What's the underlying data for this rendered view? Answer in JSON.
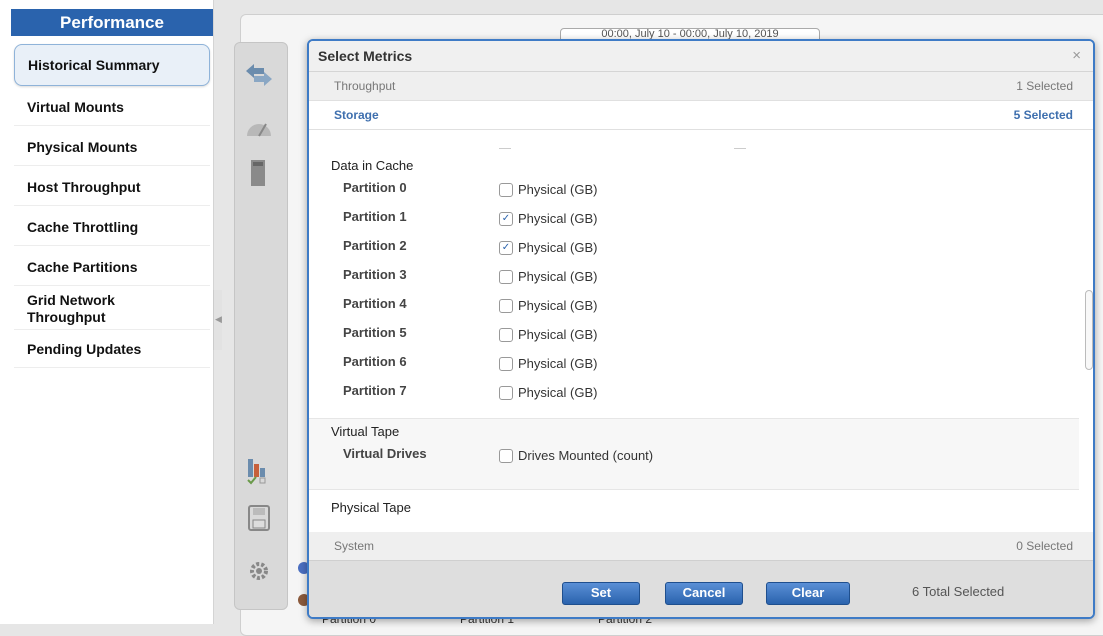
{
  "sidebar": {
    "title": "Performance",
    "items": [
      {
        "label": "Historical Summary"
      },
      {
        "label": "Virtual Mounts"
      },
      {
        "label": "Physical Mounts"
      },
      {
        "label": "Host Throughput"
      },
      {
        "label": "Cache Throttling"
      },
      {
        "label": "Cache Partitions"
      },
      {
        "label": "Grid Network Throughput"
      },
      {
        "label": "Pending Updates"
      }
    ]
  },
  "background": {
    "date_range_text": "00:00, July 10 - 00:00, July 10, 2019",
    "bottom_labels": [
      "Partition 0",
      "Partition 1",
      "Partition 2"
    ]
  },
  "dialog": {
    "title": "Select Metrics",
    "close_glyph": "×",
    "categories": [
      {
        "name": "Throughput",
        "count": "1 Selected"
      },
      {
        "name": "Storage",
        "count": "5 Selected"
      },
      {
        "name": "System",
        "count": "0 Selected"
      }
    ],
    "data_in_cache": {
      "title": "Data in Cache",
      "partitions": [
        {
          "label": "Partition 0",
          "metric": "Physical (GB)",
          "checked": false
        },
        {
          "label": "Partition 1",
          "metric": "Physical (GB)",
          "checked": true
        },
        {
          "label": "Partition 2",
          "metric": "Physical (GB)",
          "checked": true
        },
        {
          "label": "Partition 3",
          "metric": "Physical (GB)",
          "checked": false
        },
        {
          "label": "Partition 4",
          "metric": "Physical (GB)",
          "checked": false
        },
        {
          "label": "Partition 5",
          "metric": "Physical (GB)",
          "checked": false
        },
        {
          "label": "Partition 6",
          "metric": "Physical (GB)",
          "checked": false
        },
        {
          "label": "Partition 7",
          "metric": "Physical (GB)",
          "checked": false
        }
      ]
    },
    "virtual_tape": {
      "title": "Virtual Tape",
      "row_label": "Virtual Drives",
      "metric": "Drives Mounted (count)",
      "checked": false
    },
    "physical_tape": {
      "title": "Physical Tape"
    },
    "buttons": {
      "set": "Set",
      "cancel": "Cancel",
      "clear": "Clear"
    },
    "total_selected": "6 Total Selected"
  },
  "colors": {
    "accent": "#2a63ad",
    "dialog_border": "#3e7bc6",
    "storage_text": "#3e6fae"
  },
  "icons": [
    "arrows-swap-icon",
    "gauge-icon",
    "server-icon",
    "chart-check-icon",
    "save-icon",
    "gear-icon"
  ]
}
